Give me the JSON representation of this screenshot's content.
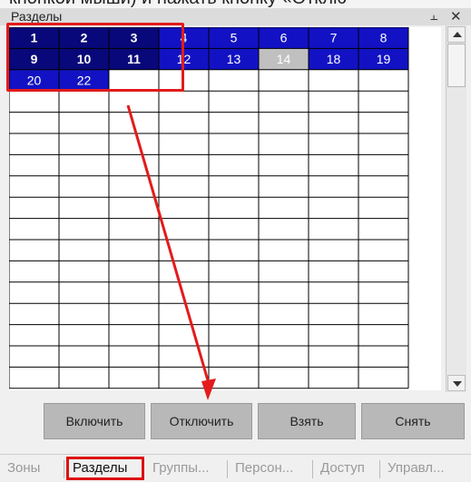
{
  "top_cut_text": "кнопкой мыши) и нажать кнопку «Отклю",
  "panel": {
    "title": "Разделы",
    "pin_icon": "pin-icon",
    "close_icon": "close-icon"
  },
  "partition_cells": [
    {
      "label": "1",
      "state": "selected"
    },
    {
      "label": "2",
      "state": "selected"
    },
    {
      "label": "3",
      "state": "selected"
    },
    {
      "label": "4",
      "state": "on"
    },
    {
      "label": "5",
      "state": "on"
    },
    {
      "label": "6",
      "state": "on"
    },
    {
      "label": "7",
      "state": "on"
    },
    {
      "label": "8",
      "state": "on"
    },
    {
      "label": "9",
      "state": "selected"
    },
    {
      "label": "10",
      "state": "selected"
    },
    {
      "label": "11",
      "state": "selected"
    },
    {
      "label": "12",
      "state": "on"
    },
    {
      "label": "13",
      "state": "on"
    },
    {
      "label": "14",
      "state": "disabled"
    },
    {
      "label": "18",
      "state": "on"
    },
    {
      "label": "19",
      "state": "on"
    },
    {
      "label": "20",
      "state": "on"
    },
    {
      "label": "22",
      "state": "on"
    }
  ],
  "colors": {
    "cell_on": "#1212c4",
    "cell_selected": "#08087a",
    "cell_disabled": "#c0c0c0",
    "grid_line": "#000000",
    "annotation": "#e31b1b"
  },
  "buttons": {
    "enable": "Включить",
    "disable": "Отключить",
    "take": "Взять",
    "remove": "Снять"
  },
  "tabs": [
    {
      "label": "Зоны",
      "active": false
    },
    {
      "label": "Разделы",
      "active": true
    },
    {
      "label": "Группы...",
      "active": false
    },
    {
      "label": "Персон...",
      "active": false
    },
    {
      "label": "Доступ",
      "active": false
    },
    {
      "label": "Управл...",
      "active": false
    }
  ]
}
